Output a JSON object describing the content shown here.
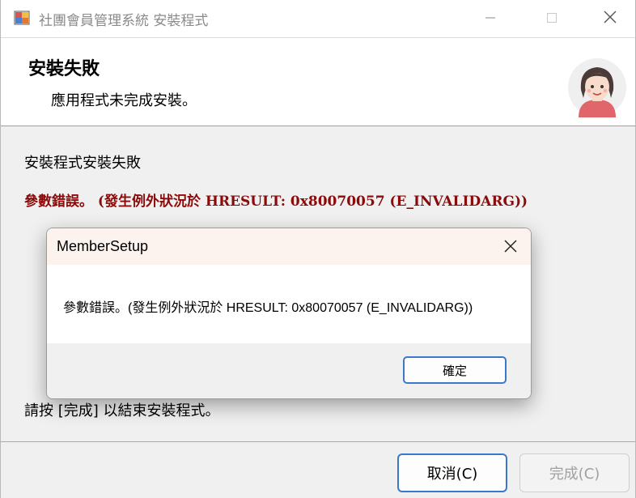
{
  "window": {
    "title": "社團會員管理系統 安裝程式",
    "minimize_icon": "minimize-icon",
    "maximize_icon": "maximize-icon",
    "close_icon": "close-icon"
  },
  "header": {
    "title": "安裝失敗",
    "subtitle": "應用程式未完成安裝。",
    "avatar_icon": "user-avatar-icon"
  },
  "body": {
    "status_text": "安裝程式安裝失敗",
    "error_text": "參數錯誤。 (發生例外狀況於 HRESULT: 0x80070057 (E_INVALIDARG))",
    "finish_instruction": "請按 [完成] 以結束安裝程式。"
  },
  "footer": {
    "cancel_label": "取消(C)",
    "finish_label": "完成(C)"
  },
  "dialog": {
    "title": "MemberSetup",
    "message": "參數錯誤。(發生例外狀況於 HRESULT: 0x80070057 (E_INVALIDARG))",
    "ok_label": "確定"
  },
  "colors": {
    "error_text": "#8b0a0a",
    "focus_border": "#3c78c9",
    "dialog_title_bg": "#fcf3ef"
  }
}
